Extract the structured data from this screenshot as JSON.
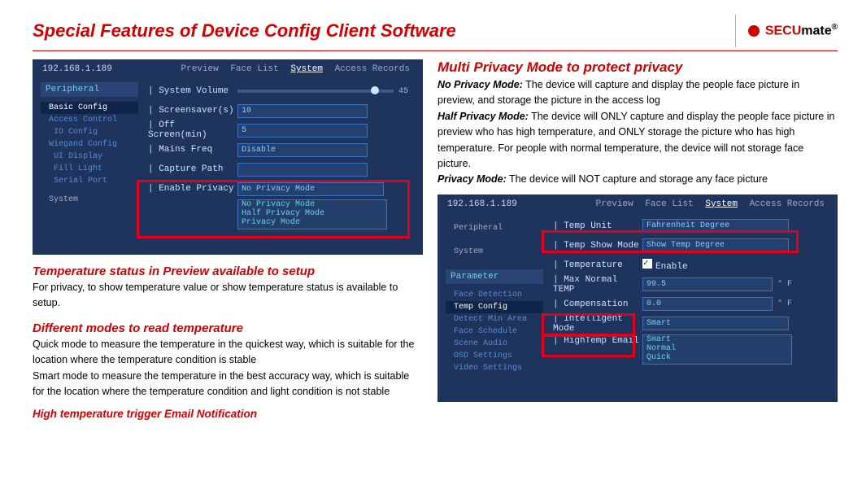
{
  "page": {
    "title": "Special Features of Device Config Client Software",
    "brand_red": "SECU",
    "brand_black": "mate",
    "brand_tm": "®"
  },
  "app1": {
    "ip": "192.168.1.189",
    "tabs": [
      "Preview",
      "Face List",
      "System",
      "Access Records"
    ],
    "active_tab": "System",
    "side_header": "Peripheral",
    "side_items": [
      "Basic Config",
      "Access Control",
      "IO Config",
      "Wiegand Config",
      "UI Display",
      "Fill Light",
      "Serial Port"
    ],
    "side_footer": "System",
    "rows": {
      "vol_label": "System Volume",
      "vol_value": "45",
      "ss_label": "Screensaver(s)",
      "ss_value": "10",
      "off_label": "Off Screen(min)",
      "off_value": "5",
      "freq_label": "Mains Freq",
      "freq_value": "Disable",
      "cap_label": "Capture Path",
      "priv_label": "Enable Privacy",
      "priv_value": "No Privacy Mode",
      "priv_opts": [
        "No Privacy Mode",
        "Half Privacy Mode",
        "Privacy Mode"
      ]
    }
  },
  "right_head": "Multi Privacy Mode to protect privacy",
  "right_desc": {
    "t1": "No Privacy Mode:",
    "d1": " The device will capture and display the people face picture in preview, and storage the picture in the access log",
    "t2": "Half Privacy Mode:",
    "d2": " The device will ONLY capture and display the people face picture in preview who has high temperature, and ONLY storage the picture who has high temperature. For people with normal temperature, the device will not storage face picture.",
    "t3": "Privacy Mode:",
    "d3": " The device will NOT capture and storage any face picture"
  },
  "left_sections": {
    "h1": "Temperature status in Preview available to setup",
    "p1": "For privacy, to show temperature value or show temperature status is available to setup.",
    "h2": "Different modes to read temperature",
    "p2a": "Quick mode to measure the temperature in the quickest way, which is suitable for the location where the temperature condition is stable",
    "p2b": "Smart mode to measure the temperature in the best accuracy way, which is suitable for the location where the temperature condition and light condition is not stable",
    "h3": "High temperature trigger Email Notification"
  },
  "app2": {
    "ip": "192.168.1.189",
    "tabs": [
      "Preview",
      "Face List",
      "System",
      "Access Records"
    ],
    "active_tab": "System",
    "side": {
      "h1": "Peripheral",
      "h2": "System",
      "h3": "Parameter",
      "items": [
        "Face Detection",
        "Temp Config",
        "Detect Min Area",
        "Face Schedule",
        "Scene Audio",
        "OSD Settings",
        "Video Settings"
      ]
    },
    "rows": {
      "unit_label": "Temp Unit",
      "unit_val": "Fahrenheit Degree",
      "show_label": "Temp Show Mode",
      "show_val": "Show Temp Degree",
      "temp_label": "Temperature",
      "temp_chk": "Enable",
      "max_label": "Max Normal TEMP",
      "max_val": "99.5",
      "max_unit": "° F",
      "comp_label": "Compensation",
      "comp_val": "0.0",
      "comp_unit": "° F",
      "intel_label": "Intelligent Mode",
      "intel_val": "Smart",
      "intel_opts": [
        "Smart",
        "Normal",
        "Quick"
      ],
      "email_label": "HighTemp Email"
    }
  }
}
